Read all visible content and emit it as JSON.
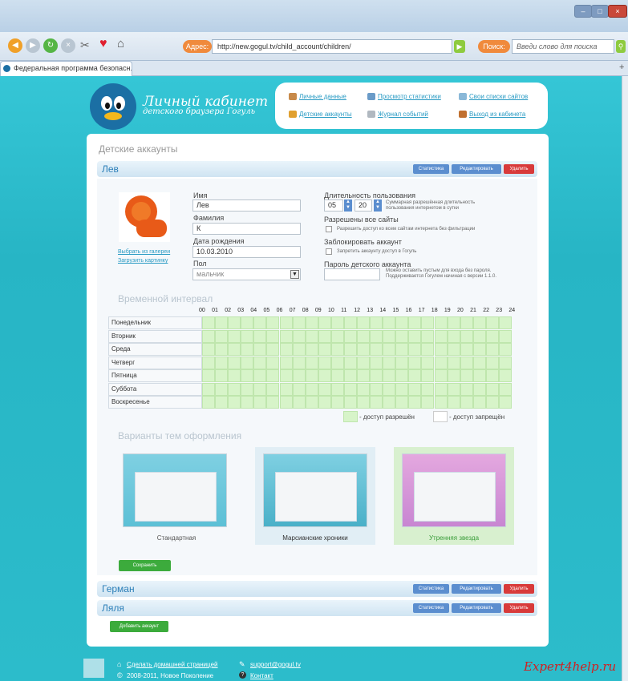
{
  "browser": {
    "address_label": "Адрес:",
    "url": "http://new.gogul.tv/child_account/children/",
    "search_label": "Поиск:",
    "search_placeholder": "Введи слово для поиска",
    "tab_title": "Федеральная программа безопасн...",
    "tab_close": "×",
    "new_tab": "+"
  },
  "header": {
    "logo_title": "Личный кабинет",
    "logo_subtitle": "детского браузера Гогуль",
    "menu": [
      {
        "label": "Личные данные",
        "icon": "user-icon"
      },
      {
        "label": "Просмотр статистики",
        "icon": "stats-icon"
      },
      {
        "label": "Свои списки сайтов",
        "icon": "list-icon"
      },
      {
        "label": "Детские аккаунты",
        "icon": "children-icon"
      },
      {
        "label": "Журнал событий",
        "icon": "journal-icon"
      },
      {
        "label": "Выход из кабинета",
        "icon": "exit-icon"
      }
    ]
  },
  "main": {
    "title": "Детские аккаунты",
    "buttons": {
      "stats": "Статистика",
      "edit": "Редактировать",
      "delete": "Удалить"
    },
    "accounts": [
      {
        "name": "Лев"
      },
      {
        "name": "Герман"
      },
      {
        "name": "Ляля"
      }
    ],
    "form": {
      "avatar_gallery": "Выбрать из галереи",
      "avatar_upload": "Загрузить картинку",
      "first_name_label": "Имя",
      "first_name": "Лев",
      "last_name_label": "Фамилия",
      "last_name": "К",
      "birthdate_label": "Дата рождения",
      "birthdate": "10.03.2010",
      "gender_label": "Пол",
      "gender": "мальчик",
      "duration_label": "Длительность пользования",
      "duration_hours": "05",
      "duration_minutes": "20",
      "duration_hint": "Суммарная разрешённая длительность пользования интернетом в сутки",
      "allowed_all_label": "Разрешены все сайты",
      "allowed_all_hint": "Разрешить доступ ко всем сайтам интернета без фильтрации",
      "blocked_label": "Заблокировать аккаунт",
      "blocked_hint": "Запретить аккаунту доступ в Гогуль",
      "password_label": "Пароль детского аккаунта",
      "password_value": "",
      "password_hint": "Можно оставить пустым для входа без пароля. Поддерживается Гогулем начиная с версии 1.1.0."
    },
    "interval": {
      "title": "Временной интервал",
      "hours": [
        "00",
        "01",
        "02",
        "03",
        "04",
        "05",
        "06",
        "07",
        "08",
        "09",
        "10",
        "11",
        "12",
        "13",
        "14",
        "15",
        "16",
        "17",
        "18",
        "19",
        "20",
        "21",
        "22",
        "23",
        "24"
      ],
      "days": [
        "Понедельник",
        "Вторник",
        "Среда",
        "Четверг",
        "Пятница",
        "Суббота",
        "Воскресенье"
      ],
      "legend_allowed": "- доступ разрешён",
      "legend_denied": "- доступ запрещён",
      "allowed_color": "#d7f4c9"
    },
    "themes": {
      "title": "Варианты тем оформления",
      "items": [
        {
          "name": "Стандартная",
          "selected": false
        },
        {
          "name": "Марсианские хроники",
          "selected": false
        },
        {
          "name": "Утренняя звезда",
          "selected": true
        }
      ]
    },
    "save_button": "Сохранить",
    "add_button": "Добавить аккаунт"
  },
  "footer": {
    "home_link": "Сделать домашней страницей",
    "copyright": "2008-2011, Новое Поколение",
    "email": "support@gogul.tv",
    "contact": "Контакт"
  },
  "watermark": "Expert4help.ru",
  "colors": {
    "accent": "#2a9bc4",
    "delete": "#d83a3a",
    "green": "#3cab3c"
  }
}
